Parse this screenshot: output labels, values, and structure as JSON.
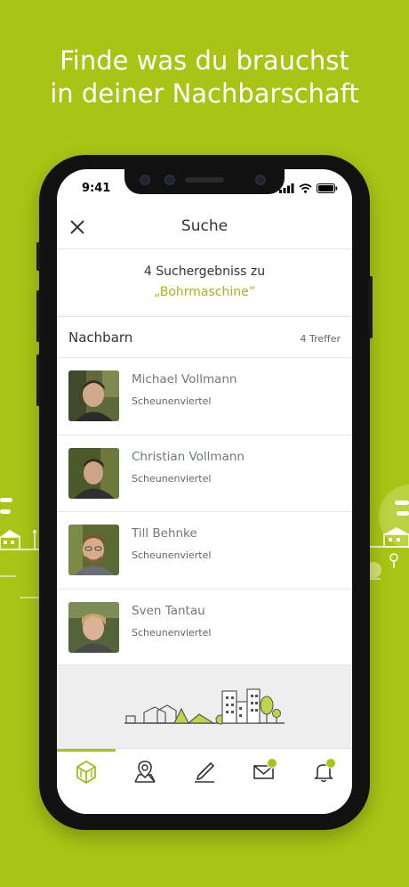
{
  "headline": {
    "line1": "Finde was du brauchst",
    "line2": "in deiner Nachbarschaft"
  },
  "colors": {
    "background": "#a8c515",
    "accent": "#9bbd16"
  },
  "status_bar": {
    "time": "9:41"
  },
  "nav": {
    "title": "Suche",
    "close_icon": "close-icon"
  },
  "results": {
    "count_text": "4 Suchergebniss zu",
    "query_text": "„Bohrmaschine”"
  },
  "section": {
    "title": "Nachbarn",
    "count": "4 Treffer"
  },
  "neighbors": [
    {
      "name": "Michael Vollmann",
      "area": "Scheunenviertel"
    },
    {
      "name": "Christian Vollmann",
      "area": "Scheunenviertel"
    },
    {
      "name": "Till Behnke",
      "area": "Scheunenviertel"
    },
    {
      "name": "Sven Tantau",
      "area": "Scheunenviertel"
    }
  ],
  "tabs": [
    {
      "icon": "neighborhood-icon",
      "active": true
    },
    {
      "icon": "map-pin-icon",
      "active": false
    },
    {
      "icon": "write-icon",
      "active": false
    },
    {
      "icon": "mail-icon",
      "active": false,
      "badge": true
    },
    {
      "icon": "bell-icon",
      "active": false,
      "badge": true
    }
  ]
}
